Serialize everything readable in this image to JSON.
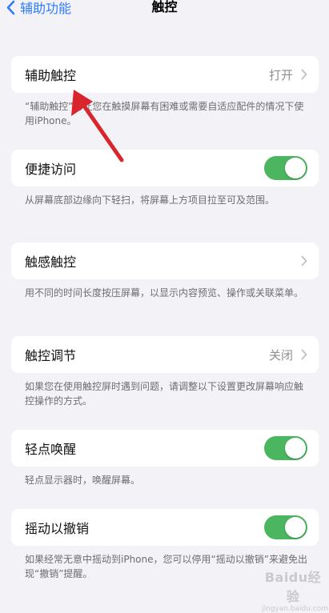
{
  "nav": {
    "back_label": "辅助功能",
    "title": "触控"
  },
  "rows": [
    {
      "label": "辅助触控",
      "value": "打开",
      "type": "disclosure",
      "footnote": "“辅助触控”可让您在触摸屏幕有困难或需要自适应配件的情况下使用iPhone。"
    },
    {
      "label": "便捷访问",
      "type": "toggle",
      "on": true,
      "footnote": "从屏幕底部边缘向下轻扫，将屏幕上方项目拉至可及范围。"
    },
    {
      "label": "触感触控",
      "value": "",
      "type": "disclosure",
      "footnote": "用不同的时间长度按压屏幕，以显示内容预览、操作或关联菜单。"
    },
    {
      "label": "触控调节",
      "value": "关闭",
      "type": "disclosure",
      "footnote": "如果您在使用触控屏时遇到问题，请调整以下设置更改屏幕响应触控操作的方式。"
    },
    {
      "label": "轻点唤醒",
      "type": "toggle",
      "on": true,
      "footnote": "轻点显示器时，唤醒屏幕。"
    },
    {
      "label": "摇动以撤销",
      "type": "toggle",
      "on": true,
      "footnote": "如果经常无意中摇动到iPhone，您可以停用“摇动以撤销”来避免出现“撤销”提醒。"
    }
  ],
  "watermark": {
    "logo": "Baidu经验",
    "site": "jingyan.baidu.com"
  },
  "colors": {
    "accent": "#2f7cf6",
    "toggle_on": "#4cb560",
    "annotation_arrow": "#d8262c",
    "background": "#f2f2f7"
  },
  "icons": {
    "back": "chevron-left-icon",
    "disclosure": "chevron-right-icon",
    "annotation": "red-arrow-icon"
  }
}
